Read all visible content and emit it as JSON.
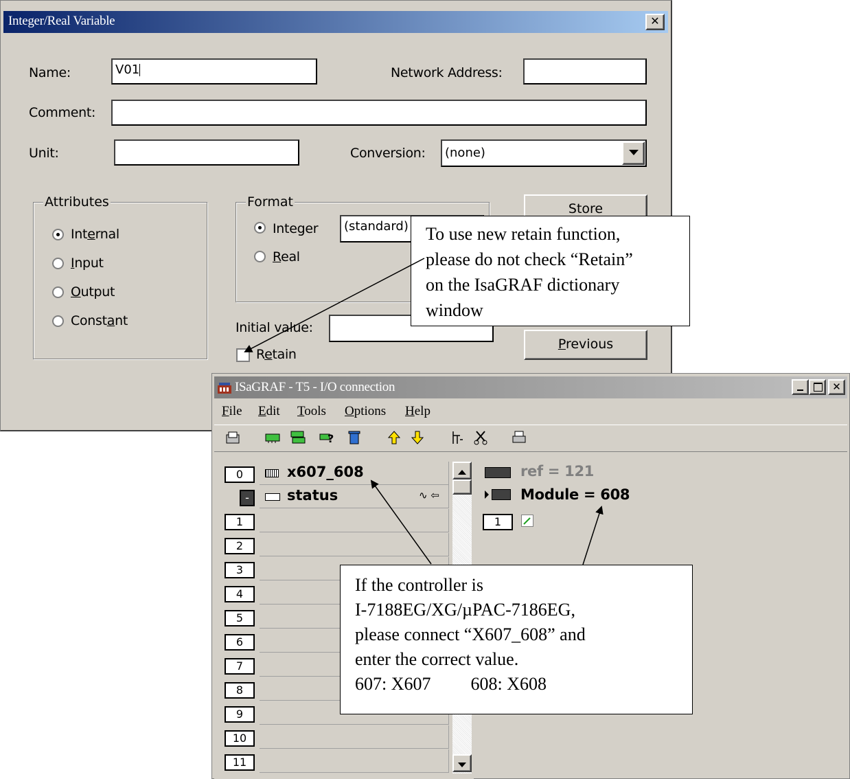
{
  "dialog": {
    "title": "Integer/Real Variable",
    "close_glyph": "✕",
    "name_label": "Name:",
    "name_value": "V01",
    "network_address_label": "Network Address:",
    "network_address_value": "",
    "comment_label": "Comment:",
    "comment_value": "",
    "unit_label": "Unit:",
    "unit_value": "",
    "conversion_label": "Conversion:",
    "conversion_value": "(none)",
    "attributes": {
      "title": "Attributes",
      "options": [
        "Internal",
        "Input",
        "Output",
        "Constant"
      ],
      "selected": "Internal"
    },
    "format": {
      "title": "Format",
      "integer_label": "Integer",
      "real_label": "Real",
      "format_select_value": "(standard)",
      "selected": "Integer"
    },
    "initial_value_label": "Initial value:",
    "initial_value": "",
    "retain_label": "Retain",
    "retain_checked": false,
    "store_button": "Store",
    "previous_button": "Previous"
  },
  "io_window": {
    "title": "ISaGRAF - T5 - I/O connection",
    "menu": [
      "File",
      "Edit",
      "Tools",
      "Options",
      "Help"
    ],
    "toolbar_icons": [
      "open-icon",
      "board-icon",
      "board-list-icon",
      "help-icon",
      "delete-icon",
      "arrow-up-icon",
      "arrow-down-icon",
      "connect-icon",
      "cut-icon",
      "print-icon"
    ],
    "slots": [
      {
        "index": "0",
        "name": "x607_608"
      },
      {
        "index": "-",
        "name": "status",
        "suffix": "∿ ⇦"
      },
      {
        "index": "1",
        "name": ""
      },
      {
        "index": "2",
        "name": ""
      },
      {
        "index": "3",
        "name": ""
      },
      {
        "index": "4",
        "name": ""
      },
      {
        "index": "5",
        "name": ""
      },
      {
        "index": "6",
        "name": ""
      },
      {
        "index": "7",
        "name": ""
      },
      {
        "index": "8",
        "name": ""
      },
      {
        "index": "9",
        "name": ""
      },
      {
        "index": "10",
        "name": ""
      },
      {
        "index": "11",
        "name": ""
      }
    ],
    "ref_text": "ref = 121",
    "module_text": "Module = 608",
    "channel_index": "1"
  },
  "callouts": {
    "retain_note": [
      "To use new retain function,",
      "please do not check “Retain”",
      "on the IsaGRAF dictionary",
      "window"
    ],
    "controller_note": [
      "If the controller is",
      "I-7188EG/XG/µPAC-7186EG,",
      "please connect “X607_608” and",
      "enter the correct value."
    ],
    "controller_note_607": "607: X607",
    "controller_note_608": "608: X608"
  },
  "colors": {
    "titlebar_start": "#0a246a",
    "titlebar_end": "#a6caf0",
    "face": "#d4d0c8"
  }
}
